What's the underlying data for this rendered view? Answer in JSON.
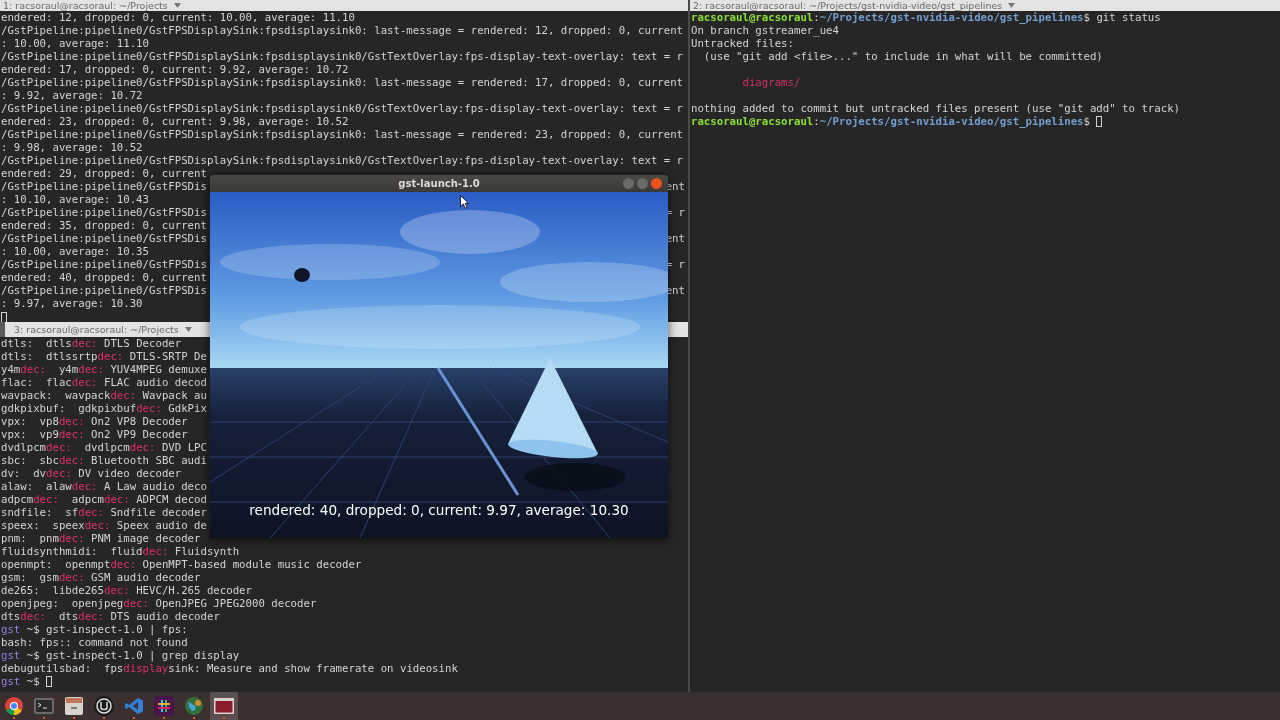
{
  "terminal_top_left": {
    "title": "1: racsoraul@racsoraul: ~/Projects",
    "lines": [
      {
        "text": "endered: 12, dropped: 0, current: 10.00, average: 11.10"
      },
      {
        "text": "/GstPipeline:pipeline0/GstFPSDisplaySink:fpsdisplaysink0: last-message = rendered: 12, dropped: 0, current"
      },
      {
        "text": ": 10.00, average: 11.10"
      },
      {
        "text": "/GstPipeline:pipeline0/GstFPSDisplaySink:fpsdisplaysink0/GstTextOverlay:fps-display-text-overlay: text = r"
      },
      {
        "text": "endered: 17, dropped: 0, current: 9.92, average: 10.72"
      },
      {
        "text": "/GstPipeline:pipeline0/GstFPSDisplaySink:fpsdisplaysink0: last-message = rendered: 17, dropped: 0, current"
      },
      {
        "text": ": 9.92, average: 10.72"
      },
      {
        "text": "/GstPipeline:pipeline0/GstFPSDisplaySink:fpsdisplaysink0/GstTextOverlay:fps-display-text-overlay: text = r"
      },
      {
        "text": "endered: 23, dropped: 0, current: 9.98, average: 10.52"
      },
      {
        "text": "/GstPipeline:pipeline0/GstFPSDisplaySink:fpsdisplaysink0: last-message = rendered: 23, dropped: 0, current"
      },
      {
        "text": ": 9.98, average: 10.52"
      },
      {
        "text": "/GstPipeline:pipeline0/GstFPSDisplaySink:fpsdisplaysink0/GstTextOverlay:fps-display-text-overlay: text = r"
      },
      {
        "text": "endered: 29, dropped: 0, current"
      },
      {
        "text": "/GstPipeline:pipeline0/GstFPSDis",
        "tail": "ent"
      },
      {
        "text": ": 10.10, average: 10.43"
      },
      {
        "text": "/GstPipeline:pipeline0/GstFPSDis",
        "tail": "= r"
      },
      {
        "text": "endered: 35, dropped: 0, current"
      },
      {
        "text": "/GstPipeline:pipeline0/GstFPSDis",
        "tail": "ent"
      },
      {
        "text": ": 10.00, average: 10.35"
      },
      {
        "text": "/GstPipeline:pipeline0/GstFPSDis",
        "tail": "= r"
      },
      {
        "text": "endered: 40, dropped: 0, current"
      },
      {
        "text": "/GstPipeline:pipeline0/GstFPSDis",
        "tail": "ent"
      },
      {
        "text": ": 9.97, average: 10.30"
      },
      {
        "cursor": true
      }
    ]
  },
  "terminal_bottom_left": {
    "title": "3: racsoraul@racsoraul: ~/Projects",
    "lines": [
      {
        "parts": [
          {
            "kind": "plain",
            "text": "dtls:  dtls"
          },
          {
            "kind": "match",
            "text": "dec:"
          },
          {
            "kind": "plain",
            "text": " DTLS Decoder"
          }
        ]
      },
      {
        "parts": [
          {
            "kind": "plain",
            "text": "dtls:  dtlssrtp"
          },
          {
            "kind": "match",
            "text": "dec:"
          },
          {
            "kind": "plain",
            "text": " DTLS-SRTP De"
          }
        ]
      },
      {
        "parts": [
          {
            "kind": "plain",
            "text": "y4m"
          },
          {
            "kind": "match",
            "text": "dec:"
          },
          {
            "kind": "plain",
            "text": "  y4m"
          },
          {
            "kind": "match",
            "text": "dec:"
          },
          {
            "kind": "plain",
            "text": " YUV4MPEG demuxe"
          }
        ]
      },
      {
        "parts": [
          {
            "kind": "plain",
            "text": "flac:  flac"
          },
          {
            "kind": "match",
            "text": "dec:"
          },
          {
            "kind": "plain",
            "text": " FLAC audio decod"
          }
        ]
      },
      {
        "parts": [
          {
            "kind": "plain",
            "text": "wavpack:  wavpack"
          },
          {
            "kind": "match",
            "text": "dec:"
          },
          {
            "kind": "plain",
            "text": " Wavpack au"
          }
        ]
      },
      {
        "parts": [
          {
            "kind": "plain",
            "text": "gdkpixbuf:  gdkpixbuf"
          },
          {
            "kind": "match",
            "text": "dec:"
          },
          {
            "kind": "plain",
            "text": " GdkPix"
          }
        ]
      },
      {
        "parts": [
          {
            "kind": "plain",
            "text": "vpx:  vp8"
          },
          {
            "kind": "match",
            "text": "dec:"
          },
          {
            "kind": "plain",
            "text": " On2 VP8 Decoder"
          }
        ]
      },
      {
        "parts": [
          {
            "kind": "plain",
            "text": "vpx:  vp9"
          },
          {
            "kind": "match",
            "text": "dec:"
          },
          {
            "kind": "plain",
            "text": " On2 VP9 Decoder"
          }
        ]
      },
      {
        "parts": [
          {
            "kind": "plain",
            "text": "dvdlpcm"
          },
          {
            "kind": "match",
            "text": "dec:"
          },
          {
            "kind": "plain",
            "text": "  dvdlpcm"
          },
          {
            "kind": "match",
            "text": "dec:"
          },
          {
            "kind": "plain",
            "text": " DVD LPC"
          }
        ]
      },
      {
        "parts": [
          {
            "kind": "plain",
            "text": "sbc:  sbc"
          },
          {
            "kind": "match",
            "text": "dec:"
          },
          {
            "kind": "plain",
            "text": " Bluetooth SBC audi"
          }
        ]
      },
      {
        "parts": [
          {
            "kind": "plain",
            "text": "dv:  dv"
          },
          {
            "kind": "match",
            "text": "dec:"
          },
          {
            "kind": "plain",
            "text": " DV video decoder"
          }
        ]
      },
      {
        "parts": [
          {
            "kind": "plain",
            "text": "alaw:  alaw"
          },
          {
            "kind": "match",
            "text": "dec:"
          },
          {
            "kind": "plain",
            "text": " A Law audio deco"
          }
        ]
      },
      {
        "parts": [
          {
            "kind": "plain",
            "text": "adpcm"
          },
          {
            "kind": "match",
            "text": "dec:"
          },
          {
            "kind": "plain",
            "text": "  adpcm"
          },
          {
            "kind": "match",
            "text": "dec:"
          },
          {
            "kind": "plain",
            "text": " ADPCM decod"
          }
        ]
      },
      {
        "parts": [
          {
            "kind": "plain",
            "text": "sndfile:  sf"
          },
          {
            "kind": "match",
            "text": "dec:"
          },
          {
            "kind": "plain",
            "text": " Sndfile decoder"
          }
        ]
      },
      {
        "parts": [
          {
            "kind": "plain",
            "text": "speex:  speex"
          },
          {
            "kind": "match",
            "text": "dec:"
          },
          {
            "kind": "plain",
            "text": " Speex audio de"
          }
        ]
      },
      {
        "parts": [
          {
            "kind": "plain",
            "text": "pnm:  pnm"
          },
          {
            "kind": "match",
            "text": "dec:"
          },
          {
            "kind": "plain",
            "text": " PNM image decoder"
          }
        ]
      },
      {
        "parts": [
          {
            "kind": "plain",
            "text": "fluidsynthmidi:  fluid"
          },
          {
            "kind": "match",
            "text": "dec:"
          },
          {
            "kind": "plain",
            "text": " Fluidsynth"
          }
        ]
      },
      {
        "parts": [
          {
            "kind": "plain",
            "text": "openmpt:  openmpt"
          },
          {
            "kind": "match",
            "text": "dec:"
          },
          {
            "kind": "plain",
            "text": " OpenMPT-based module music decoder"
          }
        ]
      },
      {
        "parts": [
          {
            "kind": "plain",
            "text": "gsm:  gsm"
          },
          {
            "kind": "match",
            "text": "dec:"
          },
          {
            "kind": "plain",
            "text": " GSM audio decoder"
          }
        ]
      },
      {
        "parts": [
          {
            "kind": "plain",
            "text": "de265:  libde265"
          },
          {
            "kind": "match",
            "text": "dec:"
          },
          {
            "kind": "plain",
            "text": " HEVC/H.265 decoder"
          }
        ]
      },
      {
        "parts": [
          {
            "kind": "plain",
            "text": "openjpeg:  openjpeg"
          },
          {
            "kind": "match",
            "text": "dec:"
          },
          {
            "kind": "plain",
            "text": " OpenJPEG JPEG2000 decoder"
          }
        ]
      },
      {
        "parts": [
          {
            "kind": "plain",
            "text": "dts"
          },
          {
            "kind": "match",
            "text": "dec:"
          },
          {
            "kind": "plain",
            "text": "  dts"
          },
          {
            "kind": "match",
            "text": "dec:"
          },
          {
            "kind": "plain",
            "text": " DTS audio decoder"
          }
        ]
      },
      {
        "parts": [
          {
            "kind": "prompt",
            "text": "gst"
          },
          {
            "kind": "plain",
            "text": " ~$ gst-inspect-1.0 | fps:"
          }
        ]
      },
      {
        "text": "bash: fps:: command not found"
      },
      {
        "parts": [
          {
            "kind": "prompt",
            "text": "gst"
          },
          {
            "kind": "plain",
            "text": " ~$ gst-inspect-1.0 | grep display"
          }
        ]
      },
      {
        "parts": [
          {
            "kind": "plain",
            "text": "debugutilsbad:  fps"
          },
          {
            "kind": "match",
            "text": "display"
          },
          {
            "kind": "plain",
            "text": "sink: Measure and show framerate on videosink"
          }
        ]
      },
      {
        "parts": [
          {
            "kind": "prompt",
            "text": "gst"
          },
          {
            "kind": "plain",
            "text": " ~$ "
          }
        ],
        "cursor": true
      }
    ]
  },
  "terminal_right": {
    "title": "2: racsoraul@racsoraul: ~/Projects/gst-nvidia-video/gst_pipelines",
    "lines": [
      {
        "parts": [
          {
            "kind": "user",
            "text": "racsoraul@racsoraul"
          },
          {
            "kind": "plain",
            "text": ":"
          },
          {
            "kind": "path",
            "text": "~/Projects/gst-nvidia-video/gst_pipelines"
          },
          {
            "kind": "plain",
            "text": "$ git status"
          }
        ]
      },
      {
        "text": "On branch gstreamer_ue4"
      },
      {
        "text": "Untracked files:"
      },
      {
        "text": "  (use \"git add <file>...\" to include in what will be committed)"
      },
      {
        "parts": [
          {
            "kind": "untracked",
            "text": "diagrams/"
          }
        ],
        "indent": true,
        "blank_before": true
      },
      {
        "text": "nothing added to commit but untracked files present (use \"git add\" to track)",
        "blank_before": true
      },
      {
        "parts": [
          {
            "kind": "user",
            "text": "racsoraul@racsoraul"
          },
          {
            "kind": "plain",
            "text": ":"
          },
          {
            "kind": "path",
            "text": "~/Projects/gst-nvidia-video/gst_pipelines"
          },
          {
            "kind": "plain",
            "text": "$ "
          }
        ],
        "cursor": true
      }
    ]
  },
  "video_window": {
    "title": "gst-launch-1.0",
    "overlay_text": "rendered: 40, dropped: 0, current: 9.97, average: 10.30"
  },
  "taskbar": [
    {
      "kind": "browser",
      "selected": false
    },
    {
      "kind": "terminal",
      "selected": false
    },
    {
      "kind": "files",
      "selected": false
    },
    {
      "kind": "round_logo",
      "selected": false
    },
    {
      "kind": "code_editor",
      "selected": false
    },
    {
      "kind": "hash_logo",
      "selected": false
    },
    {
      "kind": "globe",
      "selected": false
    },
    {
      "kind": "window",
      "selected": true
    }
  ]
}
